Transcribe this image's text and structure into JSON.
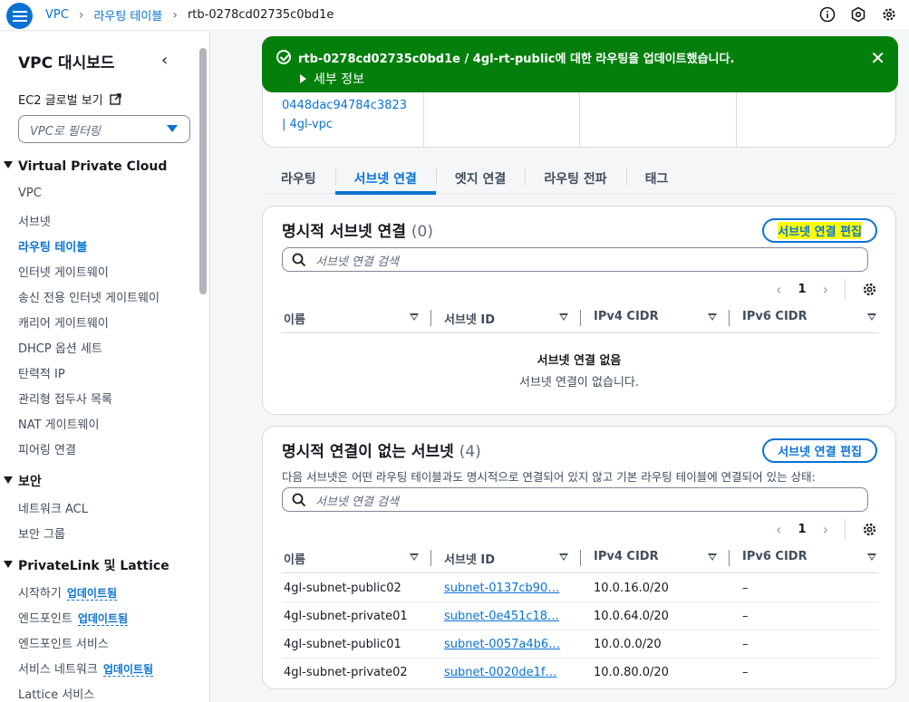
{
  "breadcrumbs": [
    "VPC",
    "라우팅 테이블",
    "rtb-0278cd02735c0bd1e"
  ],
  "sidebar": {
    "title": "VPC 대시보드",
    "ec2_link": "EC2 글로벌 보기",
    "filter_placeholder": "VPC로 필터링",
    "section_vpc": "Virtual Private Cloud",
    "vpc_items": [
      "VPC",
      "서브넷",
      "라우팅 테이블",
      "인터넷 게이트웨이",
      "송신 전용 인터넷 게이트웨이",
      "캐리어 게이트웨이",
      "DHCP 옵션 세트",
      "탄력적 IP",
      "관리형 접두사 목록",
      "NAT 게이트웨이",
      "피어링 연결"
    ],
    "section_security": "보안",
    "security_items": [
      "네트워크 ACL",
      "보안 그룹"
    ],
    "section_privatelink": "PrivateLink 및 Lattice",
    "privatelink_items": [
      {
        "label": "시작하기",
        "badge": "업데이트됨"
      },
      {
        "label": "엔드포인트",
        "badge": "업데이트됨"
      },
      {
        "label": "엔드포인트 서비스",
        "badge": ""
      },
      {
        "label": "서비스 네트워크",
        "badge": "업데이트됨"
      },
      {
        "label": "Lattice 서비스",
        "badge": ""
      }
    ]
  },
  "flash": {
    "message": "rtb-0278cd02735c0bd1e / 4gl-rt-public에 대한 라우팅을 업데이트했습니다.",
    "details": "세부 정보"
  },
  "header_card": {
    "vpc_line1": "0448dac94784c3823",
    "vpc_line2": "| 4gl-vpc"
  },
  "tabs": [
    "라우팅",
    "서브넷 연결",
    "엣지 연결",
    "라우팅 전파",
    "태그"
  ],
  "explicit": {
    "title": "명시적 서브넷 연결",
    "count": "(0)",
    "edit_button": "서브넷 연결 편집",
    "search_placeholder": "서브넷 연결 검색",
    "page": "1",
    "columns": [
      "이름",
      "서브넷 ID",
      "IPv4 CIDR",
      "IPv6 CIDR"
    ],
    "empty_title": "서브넷 연결 없음",
    "empty_sub": "서브넷 연결이 없습니다."
  },
  "implicit": {
    "title": "명시적 연결이 없는 서브넷",
    "count": "(4)",
    "edit_button": "서브넷 연결 편집",
    "description": "다음 서브넷은 어떤 라우팅 테이블과도 명시적으로 연결되어 있지 않고 기본 라우팅 테이블에 연결되어 있는 상태:",
    "search_placeholder": "서브넷 연결 검색",
    "page": "1",
    "columns": [
      "이름",
      "서브넷 ID",
      "IPv4 CIDR",
      "IPv6 CIDR"
    ],
    "rows": [
      [
        "4gl-subnet-public02",
        "subnet-0137cb90…",
        "10.0.16.0/20",
        "–"
      ],
      [
        "4gl-subnet-private01",
        "subnet-0e451c18…",
        "10.0.64.0/20",
        "–"
      ],
      [
        "4gl-subnet-public01",
        "subnet-0057a4b6…",
        "10.0.0.0/20",
        "–"
      ],
      [
        "4gl-subnet-private02",
        "subnet-0020de1f…",
        "10.0.80.0/20",
        "–"
      ]
    ]
  },
  "colors": {
    "accent": "#0972d3",
    "success": "#037f0c",
    "highlight": "#ffff00"
  }
}
